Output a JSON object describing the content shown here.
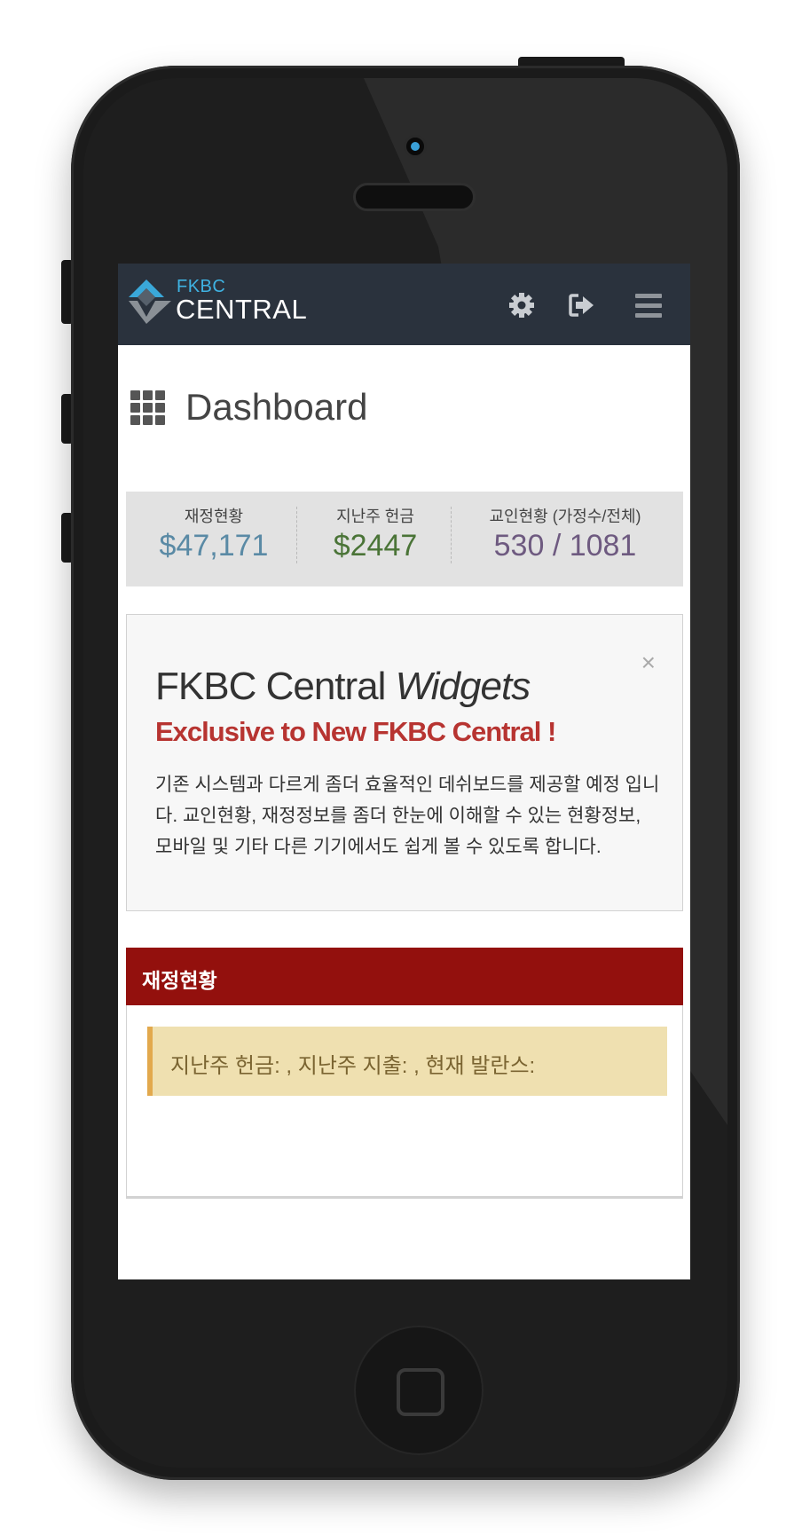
{
  "navbar": {
    "logo_top": "FKBC",
    "logo_bottom": "CENTRAL",
    "icons": [
      "gear-icon",
      "sign-out-icon",
      "hamburger-menu-icon"
    ]
  },
  "page": {
    "icon": "grid-icon",
    "title": "Dashboard"
  },
  "stats": [
    {
      "label": "재정현황",
      "value": "$47,171",
      "color": "#5a8aa5"
    },
    {
      "label": "지난주 헌금",
      "value": "$2447",
      "color": "#4a7437"
    },
    {
      "label": "교인현황 (가정수/전체)",
      "value": "530 / 1081",
      "color": "#6e5a80"
    }
  ],
  "widget": {
    "close": "×",
    "title_plain": "FKBC Central ",
    "title_italic": "Widgets",
    "subtitle": "Exclusive to New FKBC Central !",
    "body": "기존 시스템과 다르게 좀더 효율적인 데쉬보드를 제공할 예정 입니다. 교인현황, 재정정보를 좀더 한눈에 이해할 수 있는 현황정보, 모바일 및 기타 다른 기기에서도 쉽게 볼 수 있도록 합니다."
  },
  "finance_panel": {
    "title": "재정현황",
    "alert": "지난주 헌금: , 지난주 지출: , 현재 발란스:",
    "colors": {
      "header": "#93100d",
      "alert_bg": "#efe0b0",
      "alert_border": "#e2a94d"
    }
  }
}
